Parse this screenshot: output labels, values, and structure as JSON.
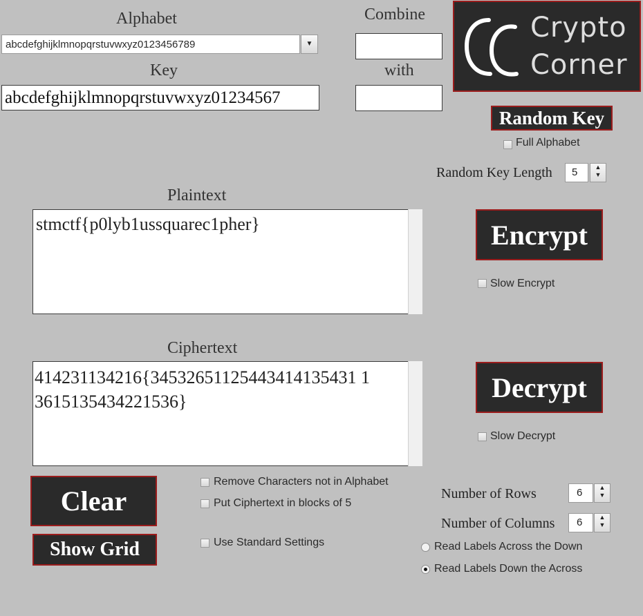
{
  "alphabet": {
    "label": "Alphabet",
    "value": "abcdefghijklmnopqrstuvwxyz0123456789"
  },
  "key": {
    "label": "Key",
    "value": "abcdefghijklmnopqrstuvwxyz01234567"
  },
  "combine": {
    "label": "Combine",
    "with_label": "with",
    "value1": "",
    "value2": ""
  },
  "logo": {
    "mark": "CC",
    "line1": "Crypto",
    "line2": "Corner"
  },
  "random_key": {
    "button": "Random Key",
    "full_alphabet": "Full Alphabet",
    "length_label": "Random Key Length",
    "length_value": "5"
  },
  "plaintext": {
    "label": "Plaintext",
    "value": "stmctf{p0lyb1ussquarec1pher}"
  },
  "ciphertext": {
    "label": "Ciphertext",
    "line1": "414231134216{34532651125443414135431 1",
    "line2": "3615135434221536}"
  },
  "encrypt": {
    "button": "Encrypt",
    "slow": "Slow Encrypt"
  },
  "decrypt": {
    "button": "Decrypt",
    "slow": "Slow Decrypt"
  },
  "options": {
    "remove_chars": "Remove Characters not in Alphabet",
    "blocks_of_5": "Put Ciphertext in blocks of 5",
    "standard_settings": "Use Standard Settings"
  },
  "grid": {
    "rows_label": "Number of Rows",
    "rows_value": "6",
    "cols_label": "Number of Columns",
    "cols_value": "6",
    "radio1": "Read Labels Across the Down",
    "radio2": "Read Labels Down the Across"
  },
  "buttons": {
    "clear": "Clear",
    "show_grid": "Show Grid"
  },
  "colors": {
    "background": "#c0c0c0",
    "button_bg": "#2a2a2a",
    "button_border": "#9b1c1c"
  }
}
